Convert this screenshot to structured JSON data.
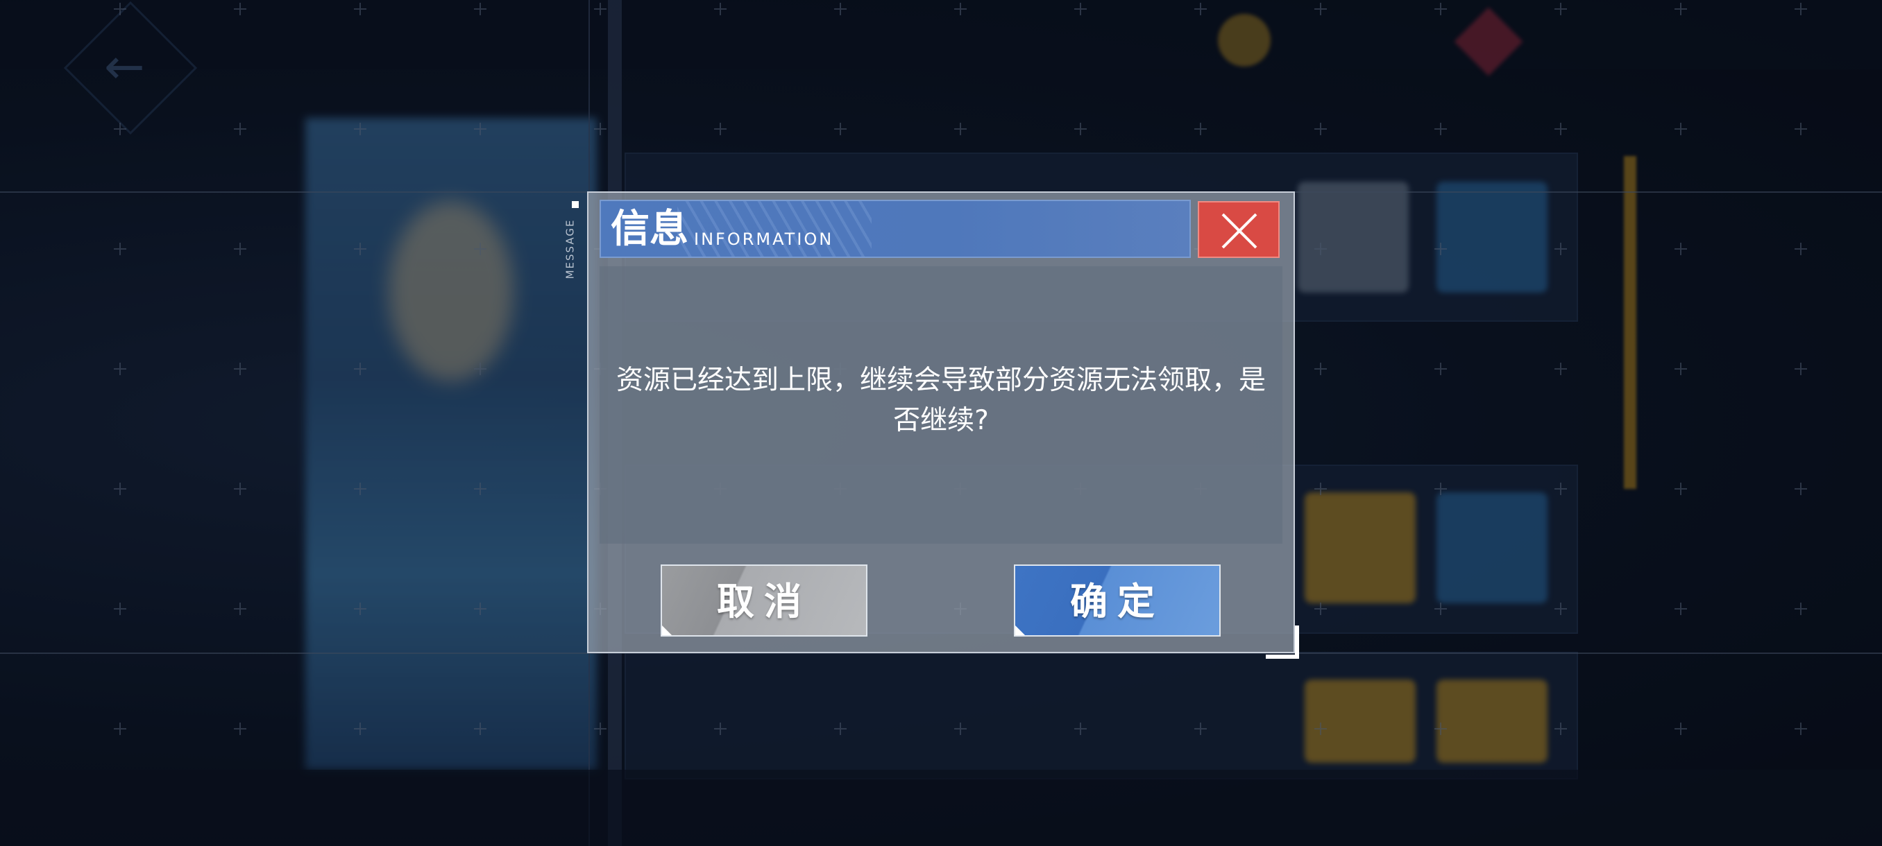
{
  "dialog": {
    "side_tag": "MESSAGE",
    "title_cn": "信息",
    "title_en": "INFORMATION",
    "close_icon": "close-icon",
    "message_line1": "资源已经达到上限，继续会导致部分资源无法领取，是",
    "message_line2": "否继续?",
    "cancel_label": "取消",
    "confirm_label": "确定"
  },
  "colors": {
    "title_bar": "#4f79bd",
    "close_button": "#d94a44",
    "confirm_button": "#3e74c4",
    "cancel_button": "#9a9c9f"
  }
}
